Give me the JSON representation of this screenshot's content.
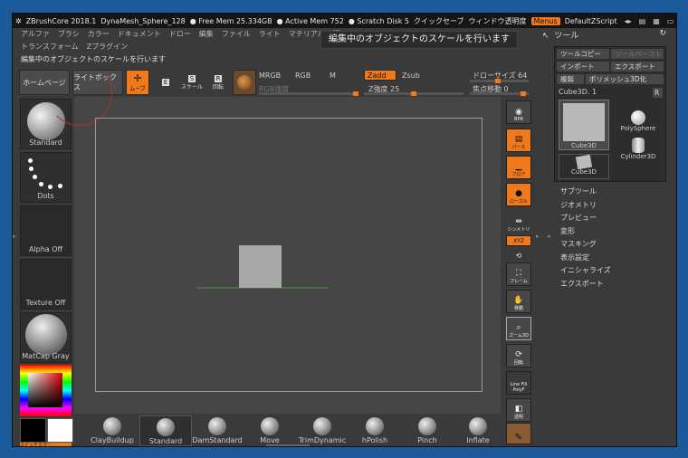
{
  "titlebar": {
    "app": "ZBrushCore 2018.1",
    "doc": "DynaMesh_Sphere_128",
    "free_mem": "● Free Mem 25.334GB",
    "active_mem": "● Active Mem 752",
    "scratch": "● Scratch Disk 5",
    "quicksave": "クイックセーブ",
    "transparency": "ウィンドウ透明度",
    "menus": "Menus",
    "script": "DefaultZScript"
  },
  "menu": {
    "row1": [
      "アルファ",
      "ブラシ",
      "カラー",
      "ドキュメント",
      "ドロー",
      "編集",
      "ファイル",
      "ライト",
      "マテリアル",
      "環"
    ],
    "row2": [
      "トランスフォーム",
      "Zプラグイン"
    ]
  },
  "tooltip": "編集中のオブジェクトのスケールを行います",
  "status": "編集中のオブジェクトのスケールを行います",
  "toolbar": {
    "home": "ホームページ",
    "lightbox": "ライトボックス",
    "move": "ムーブ",
    "edit": "E",
    "scale_icon_label": "スケール",
    "rotate_icon_label": "回転",
    "mrgb": "MRGB",
    "rgb": "RGB",
    "m": "M",
    "zadd": "Zadd",
    "zsub": "Zsub",
    "rgb_intensity": "RGB強度",
    "z_intensity": "Z強度 25",
    "draw_size": "ドローサイズ 64",
    "focal_shift": "焦点移動 0"
  },
  "left": {
    "brush": "Standard",
    "stroke": "Dots",
    "alpha": "Alpha Off",
    "texture": "Texture Off",
    "material": "MatCap Gray",
    "switch_color": "スイッチカラー"
  },
  "right_tools": [
    "BPR",
    "パース",
    "フロア",
    "ローカル",
    "シンメトリ",
    "XYZ",
    "回転",
    "フレーム",
    "移動",
    "ズーム3D",
    "回転",
    "PolyF",
    "透明"
  ],
  "tool_panel": {
    "title": "ツール",
    "copy": "ツールコピー",
    "paste": "ツールペースト",
    "import": "インポート",
    "export": "エクスポート",
    "dup": "複製",
    "polymesh": "ポリメッシュ3D化",
    "current": "Cube3D. 1",
    "r": "R",
    "items": [
      "Cube3D",
      "PolySphere",
      "Cylinder3D",
      "Cube3D"
    ]
  },
  "right_list": [
    "サブツール",
    "ジオメトリ",
    "プレビュー",
    "変形",
    "マスキング",
    "表示設定",
    "イニシャライズ",
    "エクスポート"
  ],
  "brushes": [
    "ClayBuildup",
    "Standard",
    "DamStandard",
    "Move",
    "TrimDynamic",
    "hPolish",
    "Pinch",
    "Inflate"
  ]
}
